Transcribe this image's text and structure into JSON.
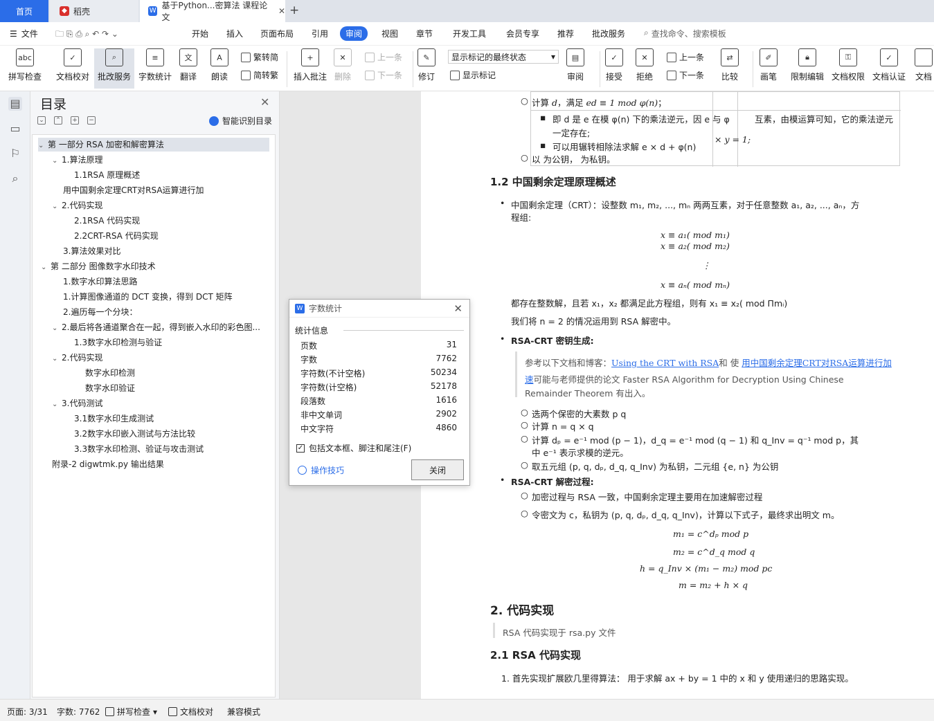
{
  "tabs": {
    "home": "首页",
    "daoke": "稻壳",
    "doc": "基于Python...密算法 课程论文"
  },
  "menu": {
    "file": "文件",
    "items": [
      "开始",
      "插入",
      "页面布局",
      "引用",
      "审阅",
      "视图",
      "章节",
      "开发工具",
      "会员专享",
      "推荐",
      "批改服务"
    ],
    "search": "查找命令、搜索模板"
  },
  "ribbon": {
    "spell": "拼写检查",
    "proof": "文档校对",
    "grade": "批改服务",
    "count": "字数统计",
    "translate": "翻译",
    "read": "朗读",
    "trad": "繁转简",
    "simp": "简转繁",
    "insert_comment": "插入批注",
    "delete": "删除",
    "prev": "上一条",
    "next": "下一条",
    "revise": "修订",
    "markup_state": "显示标记的最终状态",
    "show_markup": "显示标记",
    "review": "审阅",
    "accept": "接受",
    "reject": "拒绝",
    "prev2": "上一条",
    "next2": "下一条",
    "compare": "比较",
    "pen": "画笔",
    "restrict": "限制编辑",
    "perm": "文档权限",
    "cert": "文档认证",
    "more": "文档"
  },
  "toc": {
    "title": "目录",
    "smart": "智能识别目录",
    "items": [
      "第 一部分 RSA 加密和解密算法",
      "1.算法原理",
      "1.1RSA 原理概述",
      "用中国剩余定理CRT对RSA运算进行加",
      "2.代码实现",
      "2.1RSA 代码实现",
      "2.2CRT-RSA 代码实现",
      "3.算法效果对比",
      "第 二部分 图像数字水印技术",
      "1.数字水印算法思路",
      "1.计算图像通道的 DCT 变换，得到 DCT 矩阵",
      "2.遍历每一个分块：",
      "2.最后将各通道聚合在一起，得到嵌入水印的彩色图...",
      "1.3数字水印检测与验证",
      "2.代码实现",
      "数字水印检测",
      "数字水印验证",
      "3.代码测试",
      "3.1数字水印生成测试",
      "3.2数字水印嵌入测试与方法比较",
      "3.3数字水印检测、验证与攻击测试",
      "附录-2 digwtmk.py 输出结果"
    ]
  },
  "doc": {
    "t1": "计算",
    "t1b": "，满足",
    "t1m": "ed ≡ 1  mod  φ(n)",
    "t2": "即 d 是 e 在模 φ(n) 下的乘法逆元，因 e 与 φ",
    "t2b": "互素，由模运算可知，它的乘法逆元",
    "t3": "一定存在;",
    "t4": "可以用辗转相除法求解 e × d + φ(n)",
    "t4b": "× y  = 1;",
    "t5": "以        为公钥，        为私钥。",
    "h12": "1.2 中国剩余定理原理概述",
    "crt1": "中国剩余定理（CRT）：设整数 m₁, m₂, ..., mₙ 两两互素，对于任意整数 a₁, a₂, ..., aₙ，方",
    "crt2": "程组:",
    "eq1": "x ≡ a₁(  mod  m₁)",
    "eq2": "x ≡ a₂(  mod  m₂)",
    "eqdots": "⋮",
    "eq3": "x ≡ aₙ(  mod  mₙ)",
    "crt3": "都存在整数解，且若 x₁，x₂ 都满足此方程组，则有 x₁ ≡ x₂(  mod  Πmᵢ)",
    "crt4": "我们将 n = 2 的情况运用到 RSA 解密中。",
    "keygen": "RSA-CRT 密钥生成:",
    "ref1": "参考以下文档和博客：",
    "ref1a": "Using the CRT with RSA",
    "ref1b": "和 使",
    "ref1c": "用中国剩余定理CRT对RSA运算进行加",
    "ref2a": "速",
    "ref2b": "可能与老师提供的论文 Faster RSA Algorithm for Decryption Using Chinese",
    "ref3": "Remainder Theorem 有出入。",
    "k1": "选两个保密的大素数 p   q",
    "k2": "计算 n = q × q",
    "k3": "计算 dₚ = e⁻¹  mod (p − 1)，d_q = e⁻¹  mod (q − 1) 和  q_Inv = q⁻¹  mod  p，其",
    "k3b": "中 e⁻¹ 表示求模的逆元。",
    "k4": "取五元组 (p, q, dₚ, d_q, q_Inv) 为私钥，二元组 {e, n} 为公钥",
    "decrypt": "RSA-CRT 解密过程:",
    "d1": "加密过程与 RSA 一致，中国剩余定理主要用在加速解密过程",
    "d2": "令密文为 c，私钥为 (p, q, dₚ, d_q, q_Inv)，计算以下式子，最终求出明文 m。",
    "f1": "m₁ = c^dₚ   mod  p",
    "f2": "m₂ = c^d_q   mod  q",
    "f3": "h = q_Inv × (m₁ − m₂)   mod  pc",
    "f4": "m = m₂ + h × q",
    "h2": "2. 代码实现",
    "q2": "RSA 代码实现于 rsa.py 文件",
    "h21": "2.1 RSA 代码实现",
    "l1": "1.  首先实现扩展欧几里得算法：  用于求解 ax + by = 1 中的  x 和 y  使用递归的思路实现。"
  },
  "wordcount": {
    "title": "字数统计",
    "section": "统计信息",
    "rows": [
      {
        "label": "页数",
        "value": "31"
      },
      {
        "label": "字数",
        "value": "7762"
      },
      {
        "label": "字符数(不计空格)",
        "value": "50234"
      },
      {
        "label": "字符数(计空格)",
        "value": "52178"
      },
      {
        "label": "段落数",
        "value": "1616"
      },
      {
        "label": "非中文单词",
        "value": "2902"
      },
      {
        "label": "中文字符",
        "value": "4860"
      }
    ],
    "include": "包括文本框、脚注和尾注(F)",
    "tips": "操作技巧",
    "close": "关闭"
  },
  "status": {
    "page": "页面: 3/31",
    "words": "字数: 7762",
    "spell": "拼写检查",
    "proof": "文档校对",
    "compat": "兼容模式"
  }
}
